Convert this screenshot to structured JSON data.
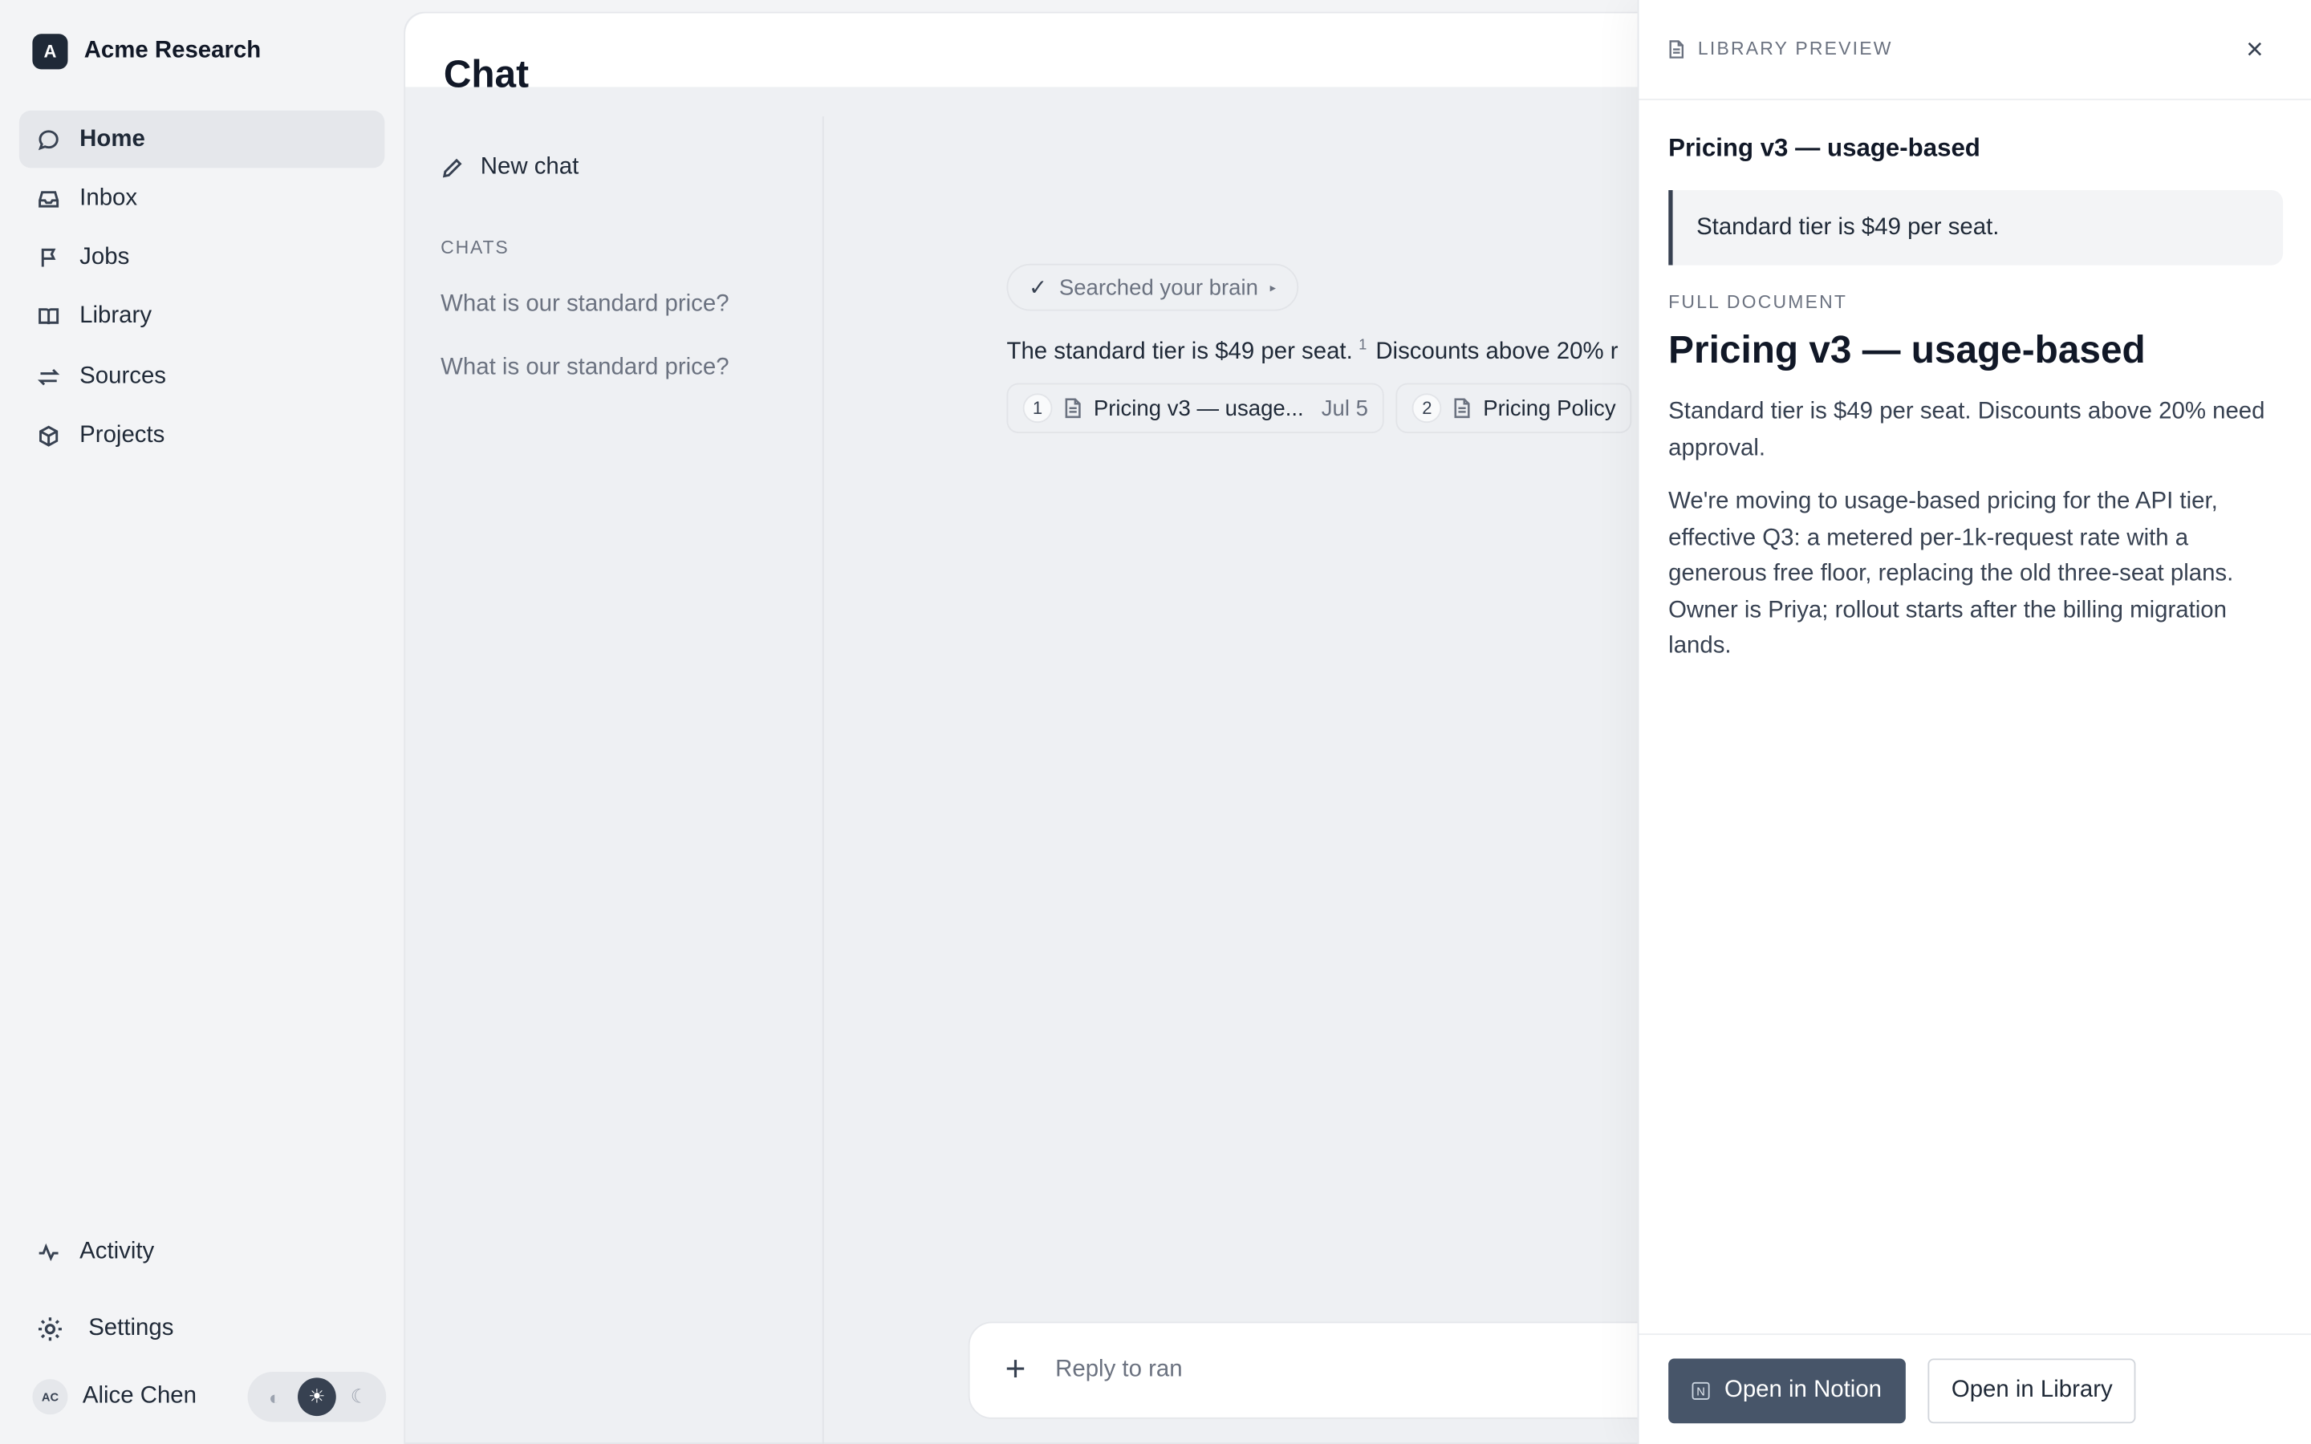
{
  "brand": {
    "logo_letter": "A",
    "name": "Acme Research"
  },
  "nav": {
    "items": [
      {
        "label": "Home",
        "icon": "chat-bubble-icon",
        "active": true
      },
      {
        "label": "Inbox",
        "icon": "inbox-icon"
      },
      {
        "label": "Jobs",
        "icon": "flag-icon"
      },
      {
        "label": "Library",
        "icon": "book-icon"
      },
      {
        "label": "Sources",
        "icon": "arrows-icon"
      },
      {
        "label": "Projects",
        "icon": "cube-icon"
      }
    ],
    "bottom": [
      {
        "label": "Activity",
        "icon": "pulse-icon"
      },
      {
        "label": "Settings",
        "icon": "gear-icon"
      }
    ]
  },
  "user": {
    "initials": "AC",
    "name": "Alice Chen",
    "theme": [
      "contrast",
      "light",
      "dark"
    ],
    "theme_active": "light"
  },
  "chat": {
    "title": "Chat",
    "new_chat_label": "New chat",
    "chats_heading": "CHATS",
    "history": [
      "What is our standard price?",
      "What is our standard price?"
    ],
    "searched_label": "Searched your brain",
    "answer_part1": "The standard tier is $49 per seat.",
    "answer_sup": "1",
    "answer_part2": "Discounts above 20% r",
    "citations": [
      {
        "num": "1",
        "title": "Pricing v3 — usage...",
        "date": "Jul 5"
      },
      {
        "num": "2",
        "title": "Pricing Policy",
        "date": ""
      }
    ],
    "composer_placeholder": "Reply to ran"
  },
  "drawer": {
    "kicker": "LIBRARY PREVIEW",
    "close": "×",
    "title": "Pricing v3 — usage-based",
    "quote": "Standard tier is $49 per seat.",
    "full_label": "FULL DOCUMENT",
    "full_title": "Pricing v3 — usage-based",
    "body": [
      "Standard tier is $49 per seat. Discounts above 20% need approval.",
      "We're moving to usage-based pricing for the API tier, effective Q3: a metered per-1k-request rate with a generous free floor, replacing the old three-seat plans. Owner is Priya; rollout starts after the billing migration lands."
    ],
    "open_notion": "Open in Notion",
    "open_library": "Open in Library"
  },
  "colors": {
    "accent": "#475569",
    "sidebar_bg": "#f3f4f6",
    "canvas_bg": "#eef0f3"
  }
}
